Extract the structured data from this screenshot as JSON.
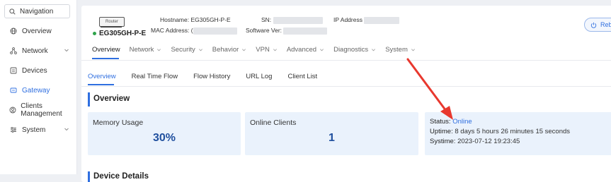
{
  "sidebar": {
    "search_label": "Navigation",
    "items": [
      {
        "label": "Overview",
        "icon": "globe-icon"
      },
      {
        "label": "Network",
        "icon": "network-icon"
      },
      {
        "label": "Devices",
        "icon": "devices-icon"
      },
      {
        "label": "Gateway",
        "icon": "gateway-icon"
      },
      {
        "label": "Clients Management",
        "icon": "clients-icon"
      },
      {
        "label": "System",
        "icon": "system-icon"
      }
    ],
    "active_color": "#2f6fe0"
  },
  "device": {
    "image_label": "Router",
    "name": "EG305GH-P-E",
    "hostname_label": "Hostname:",
    "hostname": "EG305GH-P-E",
    "mac_label": "MAC Address:",
    "mac_prefix": "(",
    "sn_label": "SN:",
    "software_label": "Software Ver:",
    "ip_label": "IP Address",
    "reboot_label": "Reb"
  },
  "top_tabs": [
    "Overview",
    "Network",
    "Security",
    "Behavior",
    "VPN",
    "Advanced",
    "Diagnostics",
    "System"
  ],
  "sub_tabs": [
    "Overview",
    "Real Time Flow",
    "Flow History",
    "URL Log",
    "Client List"
  ],
  "section_title": "Overview",
  "cards": {
    "memory": {
      "label": "Memory Usage",
      "value": "30%"
    },
    "clients": {
      "label": "Online Clients",
      "value": "1"
    },
    "status": {
      "status_label": "Status:",
      "status_value": "Online",
      "uptime_label": "Uptime:",
      "uptime_value": "8 days 5 hours 26 minutes 15 seconds",
      "systime_label": "Systime:",
      "systime_value": "2023-07-12 19:23:45"
    }
  },
  "next_section_title": "Device Details",
  "annotation_color": "#e8382e"
}
